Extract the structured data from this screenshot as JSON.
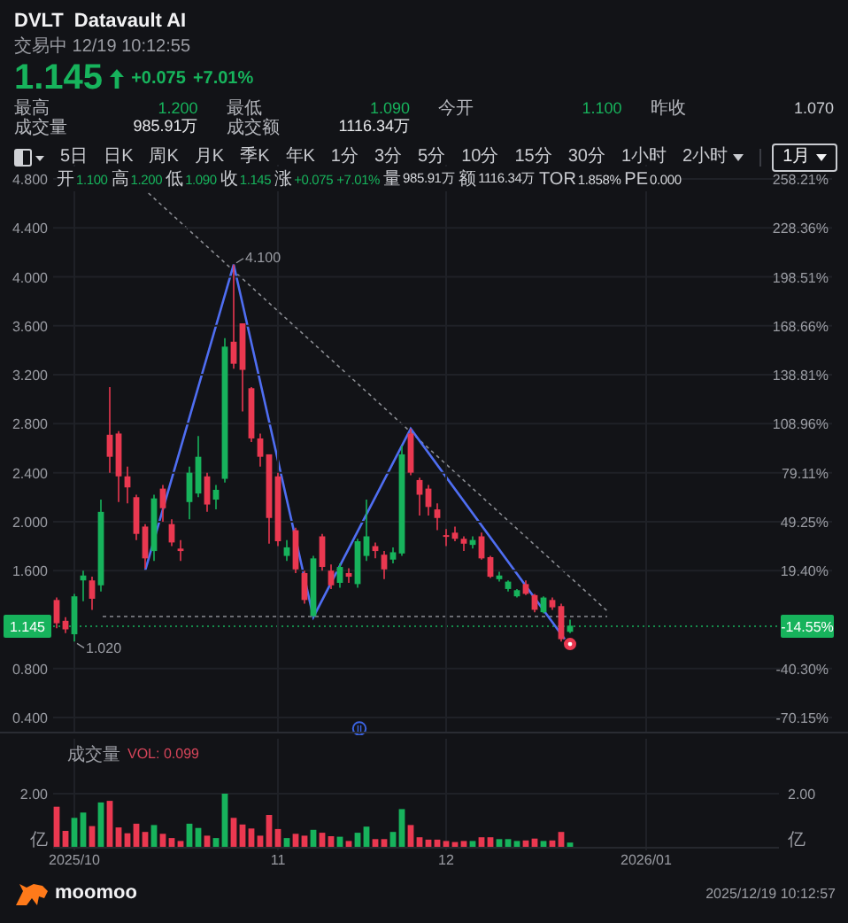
{
  "quote": {
    "symbol": "DVLT",
    "name": "Datavault AI",
    "status": "交易中 12/19 10:12:55",
    "price": "1.145",
    "change": "+0.075",
    "change_pct": "+7.01%"
  },
  "stats": [
    {
      "label": "最高",
      "value": "1.200",
      "color": "#17b35c"
    },
    {
      "label": "最低",
      "value": "1.090",
      "color": "#17b35c"
    },
    {
      "label": "今开",
      "value": "1.100",
      "color": "#17b35c"
    },
    {
      "label": "昨收",
      "value": "1.070",
      "color": "#c9cbd0"
    },
    {
      "label": "成交量",
      "value": "985.91万",
      "color": "#e6e7ea"
    },
    {
      "label": "成交额",
      "value": "1116.34万",
      "color": "#e6e7ea"
    }
  ],
  "toolbar": {
    "tabs": [
      {
        "label": "5日",
        "selected": false,
        "kind": "tab"
      },
      {
        "label": "日K",
        "selected": false,
        "kind": "tab"
      },
      {
        "label": "周K",
        "selected": false,
        "kind": "tab"
      },
      {
        "label": "月K",
        "selected": false,
        "kind": "tab"
      },
      {
        "label": "季K",
        "selected": false,
        "kind": "tab"
      },
      {
        "label": "年K",
        "selected": false,
        "kind": "tab"
      },
      {
        "label": "1分",
        "selected": false,
        "kind": "tab"
      },
      {
        "label": "3分",
        "selected": false,
        "kind": "tab"
      },
      {
        "label": "5分",
        "selected": false,
        "kind": "tab"
      },
      {
        "label": "10分",
        "selected": false,
        "kind": "tab"
      },
      {
        "label": "15分",
        "selected": false,
        "kind": "tab"
      },
      {
        "label": "30分",
        "selected": false,
        "kind": "tab"
      },
      {
        "label": "1小时",
        "selected": false,
        "kind": "tab"
      },
      {
        "label": "2小时",
        "selected": false,
        "kind": "menu"
      },
      {
        "label": "1月",
        "selected": true,
        "kind": "range"
      }
    ]
  },
  "chart": {
    "info": [
      {
        "label": "开",
        "value": "1.100",
        "color": "#17b35c"
      },
      {
        "label": "高",
        "value": "1.200",
        "color": "#17b35c"
      },
      {
        "label": "低",
        "value": "1.090",
        "color": "#17b35c"
      },
      {
        "label": "收",
        "value": "1.145",
        "color": "#17b35c"
      },
      {
        "label": "涨",
        "value": "+0.075",
        "color": "#17b35c"
      },
      {
        "value": "+7.01%",
        "color": "#17b35c"
      },
      {
        "label": "量",
        "value": "985.91万",
        "color": "#d5d7db"
      },
      {
        "label": "额",
        "value": "1116.34万",
        "color": "#d5d7db"
      },
      {
        "label": "TOR",
        "value": "1.858%",
        "color": "#d5d7db"
      },
      {
        "label": "PE",
        "value": "0.000",
        "color": "#d5d7db"
      }
    ],
    "price_tag": "1.145",
    "percent_tag": "-14.55%",
    "percent_axis": [
      "258.21%",
      "228.36%",
      "198.51%",
      "168.66%",
      "138.81%",
      "108.96%",
      "79.11%",
      "49.25%",
      "19.40%",
      "-40.30%",
      "-70.15%"
    ],
    "chart_data": {
      "type": "candlestick",
      "ylim": [
        0.4,
        4.8
      ],
      "categories": [
        null,
        null,
        null,
        null,
        null,
        null,
        null,
        null,
        null,
        null,
        null,
        null,
        null,
        null,
        null,
        null,
        null,
        null,
        null,
        null,
        null,
        null,
        null,
        null,
        null,
        null,
        null,
        null,
        null,
        null,
        null,
        null,
        null,
        null,
        null,
        null,
        null,
        null,
        null,
        null,
        null,
        null,
        null,
        null,
        null,
        null,
        null,
        null,
        null,
        null,
        null,
        null,
        null,
        null,
        null,
        null,
        null,
        null,
        null
      ],
      "yticks": [
        {
          "value": 4.8,
          "label": "4.800"
        },
        {
          "value": 4.4,
          "label": "4.400"
        },
        {
          "value": 4.0,
          "label": "4.000"
        },
        {
          "value": 3.6,
          "label": "3.600"
        },
        {
          "value": 3.2,
          "label": "3.200"
        },
        {
          "value": 2.8,
          "label": "2.800"
        },
        {
          "value": 2.4,
          "label": "2.400"
        },
        {
          "value": 2.0,
          "label": "2.000"
        },
        {
          "value": 1.6,
          "label": "1.600"
        },
        {
          "value": 0.8,
          "label": "0.800"
        },
        {
          "value": 0.4,
          "label": "0.400"
        }
      ],
      "grid": true,
      "ohlc": [
        [
          1.36,
          1.38,
          1.13,
          1.17
        ],
        [
          1.19,
          1.22,
          1.09,
          1.12
        ],
        [
          1.08,
          1.41,
          1.02,
          1.39
        ],
        [
          1.52,
          1.6,
          1.35,
          1.56
        ],
        [
          1.52,
          1.55,
          1.28,
          1.37
        ],
        [
          1.48,
          2.18,
          1.43,
          2.08
        ],
        [
          2.71,
          3.1,
          2.4,
          2.53
        ],
        [
          2.72,
          2.74,
          2.16,
          2.37
        ],
        [
          2.37,
          2.45,
          2.15,
          2.28
        ],
        [
          2.2,
          2.22,
          1.85,
          1.9
        ],
        [
          1.96,
          1.98,
          1.62,
          1.7
        ],
        [
          1.76,
          2.22,
          1.68,
          2.19
        ],
        [
          2.27,
          2.3,
          2.0,
          2.11
        ],
        [
          1.98,
          2.02,
          1.8,
          1.83
        ],
        [
          1.78,
          1.85,
          1.68,
          1.76
        ],
        [
          2.16,
          2.45,
          2.02,
          2.4
        ],
        [
          2.23,
          2.7,
          2.2,
          2.53
        ],
        [
          2.37,
          2.4,
          2.08,
          2.14
        ],
        [
          2.18,
          2.3,
          2.1,
          2.26
        ],
        [
          2.35,
          3.5,
          2.32,
          3.43
        ],
        [
          3.47,
          4.1,
          3.25,
          3.29
        ],
        [
          3.62,
          3.62,
          2.9,
          3.24
        ],
        [
          3.09,
          3.1,
          2.65,
          2.68
        ],
        [
          2.68,
          2.72,
          2.45,
          2.53
        ],
        [
          2.55,
          2.55,
          1.82,
          2.03
        ],
        [
          2.37,
          2.4,
          1.8,
          1.84
        ],
        [
          1.72,
          1.85,
          1.68,
          1.79
        ],
        [
          1.93,
          1.95,
          1.58,
          1.61
        ],
        [
          1.58,
          1.6,
          1.33,
          1.36
        ],
        [
          1.23,
          1.72,
          1.22,
          1.7
        ],
        [
          1.88,
          1.9,
          1.6,
          1.63
        ],
        [
          1.6,
          1.65,
          1.45,
          1.48
        ],
        [
          1.5,
          1.66,
          1.46,
          1.63
        ],
        [
          1.58,
          1.62,
          1.5,
          1.55
        ],
        [
          1.49,
          1.86,
          1.46,
          1.84
        ],
        [
          1.72,
          2.18,
          1.68,
          1.88
        ],
        [
          1.8,
          1.83,
          1.7,
          1.76
        ],
        [
          1.73,
          1.76,
          1.53,
          1.61
        ],
        [
          1.69,
          1.79,
          1.66,
          1.75
        ],
        [
          1.74,
          2.62,
          1.72,
          2.55
        ],
        [
          2.72,
          2.76,
          2.38,
          2.4
        ],
        [
          2.34,
          2.36,
          2.05,
          2.22
        ],
        [
          2.27,
          2.3,
          2.05,
          2.12
        ],
        [
          2.1,
          2.15,
          1.93,
          2.03
        ],
        [
          1.89,
          1.94,
          1.8,
          1.88
        ],
        [
          1.91,
          1.96,
          1.84,
          1.86
        ],
        [
          1.86,
          1.88,
          1.76,
          1.82
        ],
        [
          1.81,
          1.88,
          1.78,
          1.85
        ],
        [
          1.88,
          1.91,
          1.69,
          1.7
        ],
        [
          1.71,
          1.72,
          1.54,
          1.55
        ],
        [
          1.53,
          1.59,
          1.51,
          1.56
        ],
        [
          1.45,
          1.52,
          1.43,
          1.51
        ],
        [
          1.39,
          1.45,
          1.38,
          1.44
        ],
        [
          1.49,
          1.52,
          1.4,
          1.41
        ],
        [
          1.4,
          1.41,
          1.26,
          1.28
        ],
        [
          1.26,
          1.39,
          1.25,
          1.38
        ],
        [
          1.36,
          1.38,
          1.28,
          1.3
        ],
        [
          1.31,
          1.33,
          1.02,
          1.04
        ],
        [
          1.1,
          1.2,
          1.09,
          1.15
        ]
      ],
      "annotations": [
        {
          "text": "4.100"
        },
        {
          "text": "1.020"
        }
      ]
    }
  },
  "volume": {
    "title": "成交量",
    "indicator": "VOL: 0.099",
    "right_axis": [
      "2.00",
      "亿"
    ],
    "axis_end_label": "2026/01",
    "chart_data": {
      "type": "bar",
      "ylim": [
        0,
        2
      ],
      "grid": true,
      "ylabel": "亿",
      "categories": [
        null,
        null,
        "2025/10",
        null,
        null,
        null,
        null,
        null,
        null,
        null,
        null,
        null,
        null,
        null,
        null,
        null,
        null,
        null,
        null,
        null,
        null,
        null,
        null,
        null,
        null,
        "11",
        null,
        null,
        null,
        null,
        null,
        null,
        null,
        null,
        null,
        null,
        null,
        null,
        null,
        null,
        null,
        null,
        null,
        null,
        "12",
        null,
        null,
        null,
        null,
        null,
        null,
        null,
        null,
        null,
        null,
        null,
        null,
        null,
        null
      ],
      "yticks": [
        {
          "value": 2,
          "label": "2.00"
        }
      ],
      "values": [
        1.51,
        0.6,
        1.09,
        1.29,
        0.78,
        1.67,
        1.73,
        0.73,
        0.51,
        0.87,
        0.56,
        0.82,
        0.49,
        0.33,
        0.22,
        0.87,
        0.71,
        0.42,
        0.33,
        2.0,
        1.09,
        0.84,
        0.69,
        0.42,
        1.2,
        0.67,
        0.33,
        0.49,
        0.42,
        0.64,
        0.53,
        0.4,
        0.38,
        0.22,
        0.53,
        0.76,
        0.29,
        0.29,
        0.56,
        1.42,
        0.82,
        0.36,
        0.27,
        0.27,
        0.22,
        0.18,
        0.22,
        0.22,
        0.36,
        0.36,
        0.29,
        0.29,
        0.22,
        0.24,
        0.31,
        0.22,
        0.24,
        0.56,
        0.16
      ]
    }
  },
  "footer": {
    "brand": "moomoo",
    "timestamp": "2025/12/19 10:12:57"
  }
}
